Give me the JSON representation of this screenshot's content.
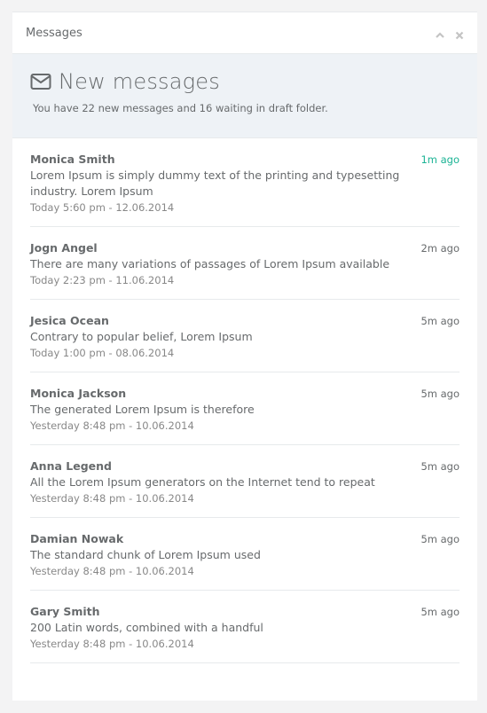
{
  "panel": {
    "title": "Messages"
  },
  "header": {
    "icon": "envelope-icon",
    "title": "New messages",
    "subtitle": "You have 22 new messages and 16 waiting in draft folder."
  },
  "messages": [
    {
      "name": "Monica Smith",
      "text": "Lorem Ipsum is simply dummy text of the printing and typesetting industry. Lorem Ipsum",
      "date": "Today 5:60 pm - 12.06.2014",
      "ago": "1m ago"
    },
    {
      "name": "Jogn Angel",
      "text": "There are many variations of passages of Lorem Ipsum available",
      "date": "Today 2:23 pm - 11.06.2014",
      "ago": "2m ago"
    },
    {
      "name": "Jesica Ocean",
      "text": "Contrary to popular belief, Lorem Ipsum",
      "date": "Today 1:00 pm - 08.06.2014",
      "ago": "5m ago"
    },
    {
      "name": "Monica Jackson",
      "text": "The generated Lorem Ipsum is therefore",
      "date": "Yesterday 8:48 pm - 10.06.2014",
      "ago": "5m ago"
    },
    {
      "name": "Anna Legend",
      "text": "All the Lorem Ipsum generators on the Internet tend to repeat",
      "date": "Yesterday 8:48 pm - 10.06.2014",
      "ago": "5m ago"
    },
    {
      "name": "Damian Nowak",
      "text": "The standard chunk of Lorem Ipsum used",
      "date": "Yesterday 8:48 pm - 10.06.2014",
      "ago": "5m ago"
    },
    {
      "name": "Gary Smith",
      "text": "200 Latin words, combined with a handful",
      "date": "Yesterday 8:48 pm - 10.06.2014",
      "ago": "5m ago"
    }
  ],
  "colors": {
    "accent": "#1ab394",
    "header_bg": "#eef2f6",
    "page_bg": "#f3f3f4"
  }
}
